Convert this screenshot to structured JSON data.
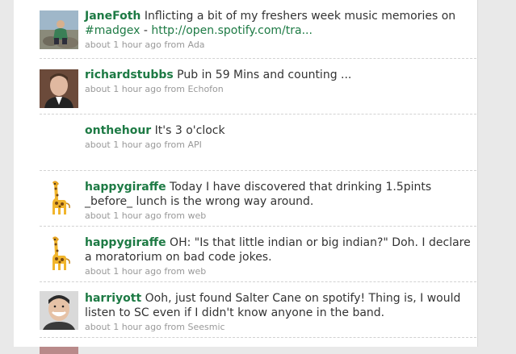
{
  "tweets": [
    {
      "user": "JaneFoth",
      "text_before": "Inflicting a bit of my freshers week music memories on ",
      "hashtag": "#madgex",
      "text_mid": " - ",
      "link": "http://open.spotify.com/tra...",
      "time": "about 1 hour ago",
      "from": "from",
      "source": "Ada",
      "avatar_icon": "photo-person-on-rocks"
    },
    {
      "user": "richardstubbs",
      "text": "Pub in 59 Mins and counting ...",
      "time": "about 1 hour ago",
      "from": "from",
      "source": "Echofon",
      "avatar_icon": "photo-man-headshot"
    },
    {
      "user": "onthehour",
      "text": "It's 3 o'clock",
      "time": "about 1 hour ago",
      "from": "from",
      "source": "API",
      "avatar_icon": "none"
    },
    {
      "user": "happygiraffe",
      "text": "Today I have discovered that drinking 1.5pints _before_ lunch is the wrong way around.",
      "time": "about 1 hour ago",
      "from": "from",
      "source": "web",
      "avatar_icon": "giraffe-icon"
    },
    {
      "user": "happygiraffe",
      "text": "OH: \"Is that little indian or big indian?\" Doh. I declare a moratorium on bad code jokes.",
      "time": "about 1 hour ago",
      "from": "from",
      "source": "web",
      "avatar_icon": "giraffe-icon"
    },
    {
      "user": "harriyott",
      "text": "Ooh, just found Salter Cane on spotify! Thing is, I would listen to SC even if I didn't know anyone in the band.",
      "time": "about 1 hour ago",
      "from": "from",
      "source": "Seesmic",
      "avatar_icon": "photo-man-smiling"
    }
  ]
}
